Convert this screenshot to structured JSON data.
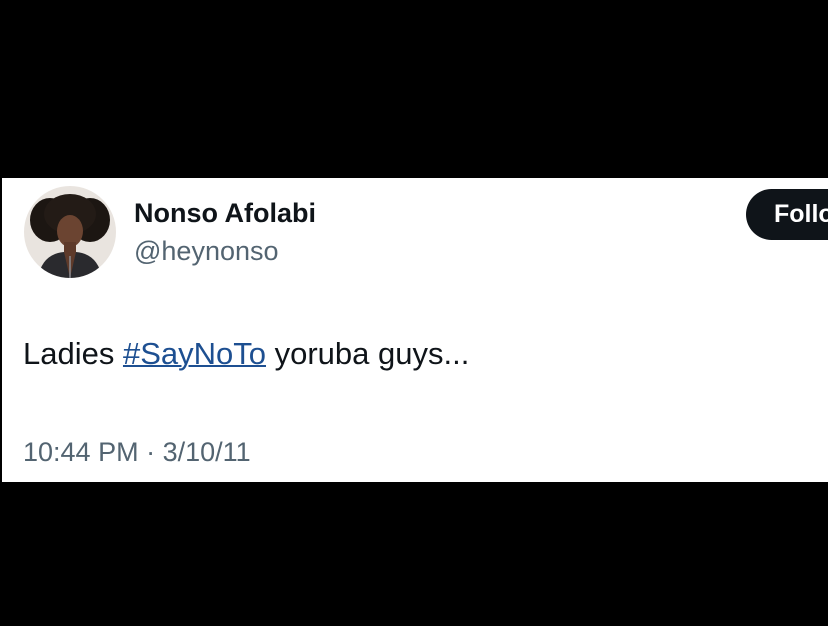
{
  "tweet": {
    "author": {
      "display_name": "Nonso Afolabi",
      "handle": "@heynonso"
    },
    "follow_label": "Follow",
    "text": {
      "before": "Ladies ",
      "hashtag": "#SayNoTo",
      "after": " yoruba guys..."
    },
    "meta": {
      "time": "10:44 PM",
      "separator": " · ",
      "date": "3/10/11"
    }
  },
  "colors": {
    "background": "#000000",
    "card": "#ffffff",
    "text_primary": "#0f1419",
    "text_secondary": "#536471",
    "hashtag": "#1d4f91",
    "button": "#0f1419"
  }
}
